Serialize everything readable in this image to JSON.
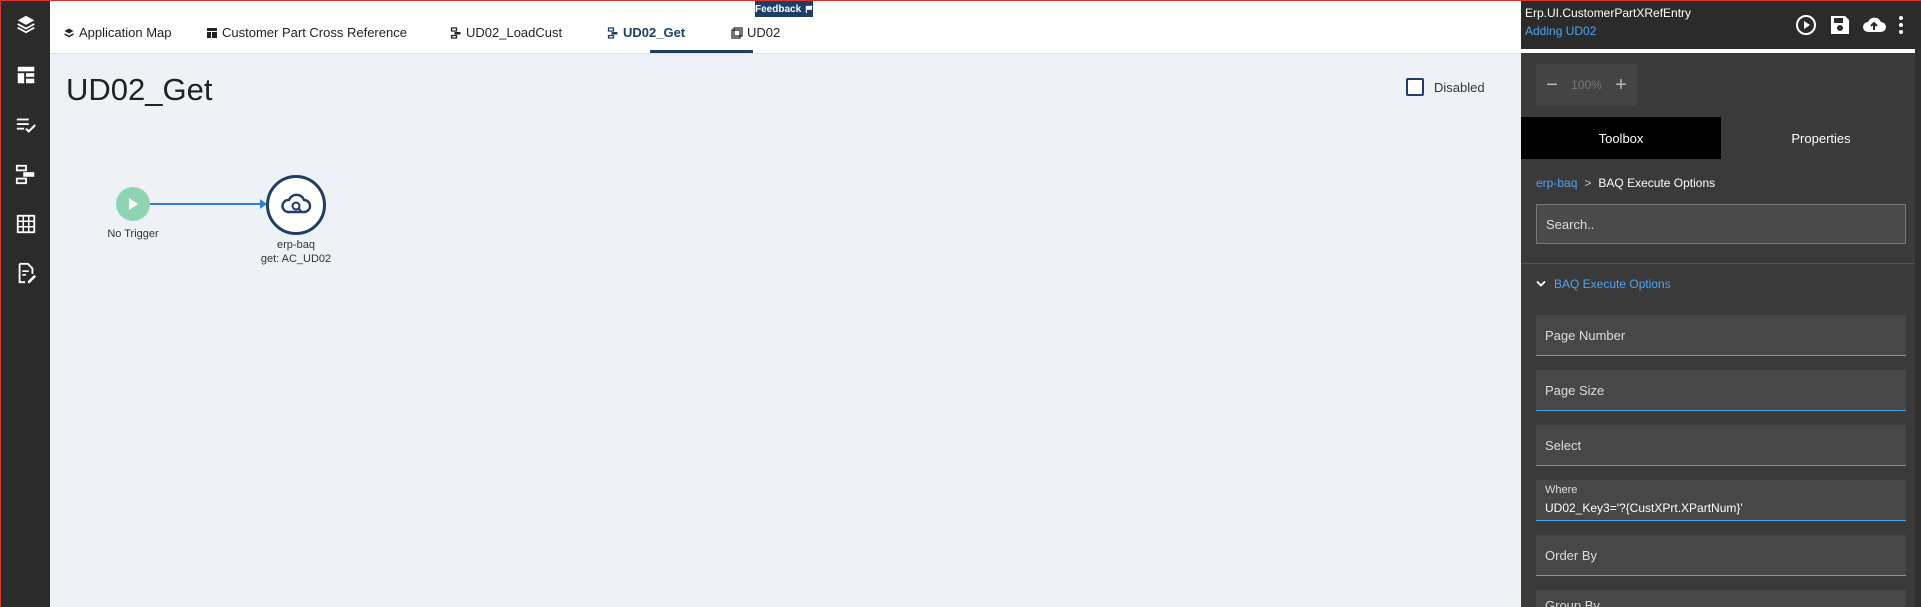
{
  "rail": {
    "items": [
      "layers-icon",
      "layout-icon",
      "checklist-icon",
      "data-flow-icon",
      "grid-view-icon",
      "edit-doc-icon"
    ]
  },
  "tabs": [
    {
      "label": "Application Map",
      "icon": "layers-icon"
    },
    {
      "label": "Customer Part Cross Reference",
      "icon": "layout-icon"
    },
    {
      "label": "UD02_LoadCust",
      "icon": "data-flow-icon"
    },
    {
      "label": "UD02_Get",
      "icon": "data-flow-icon",
      "active": true
    },
    {
      "label": "UD02",
      "icon": "grid-view-icon"
    }
  ],
  "feedback": {
    "label": "Feedback"
  },
  "canvas": {
    "title": "UD02_Get",
    "disabled_label": "Disabled",
    "trigger_label": "No Trigger",
    "baq_label": "erp-baq",
    "baq_sub": "get: AC_UD02"
  },
  "panel": {
    "title": "Erp.UI.CustomerPartXRefEntry",
    "subtitle": "Adding UD02",
    "zoom": {
      "minus": "−",
      "value": "100%",
      "plus": "+"
    },
    "tabs": {
      "toolbox": "Toolbox",
      "properties": "Properties"
    },
    "breadcrumb": {
      "root": "erp-baq",
      "sep": ">",
      "current": "BAQ Execute Options"
    },
    "search_placeholder": "Search..",
    "section": "BAQ Execute Options",
    "fields": [
      {
        "label": "Page Number",
        "value": ""
      },
      {
        "label": "Page Size",
        "value": ""
      },
      {
        "label": "Select",
        "value": ""
      },
      {
        "label": "Where",
        "value": "UD02_Key3='?{CustXPrt.XPartNum}'"
      },
      {
        "label": "Order By",
        "value": ""
      },
      {
        "label": "Group By",
        "value": ""
      }
    ]
  },
  "colors": {
    "accent": "#1d3f63",
    "link": "#4ea3f1",
    "trigger": "#8fd4b0",
    "panel_bg": "#3a3a3a",
    "rail_bg": "#2b2b2b"
  }
}
